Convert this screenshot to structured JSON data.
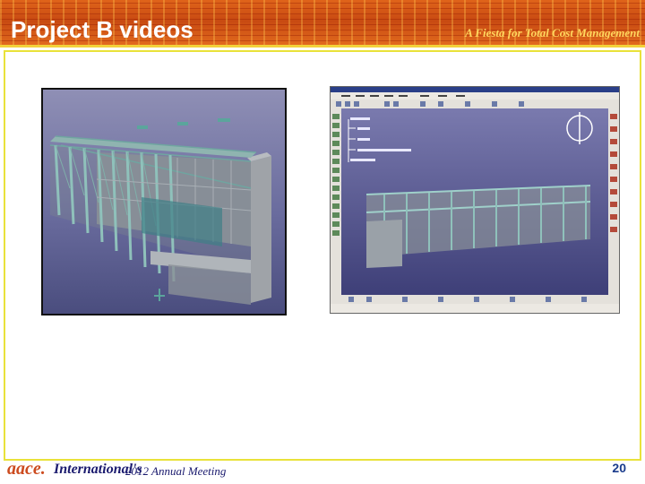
{
  "header": {
    "title": "Project B videos",
    "tagline": "A Fiesta for Total Cost Management",
    "colors": {
      "band": "#d4561a",
      "title": "#ffffff",
      "tagline": "#ffd75e",
      "rule": "#f3d23a"
    }
  },
  "images": [
    {
      "name": "structure-3d-model",
      "icon": "steel-frame-rendering"
    },
    {
      "name": "catia-screenshot",
      "icon": "cad-application-window"
    }
  ],
  "footer": {
    "brand": "aace.",
    "brand_suffix": "International's",
    "meeting": "2012 Annual Meeting",
    "page_number": "20"
  }
}
